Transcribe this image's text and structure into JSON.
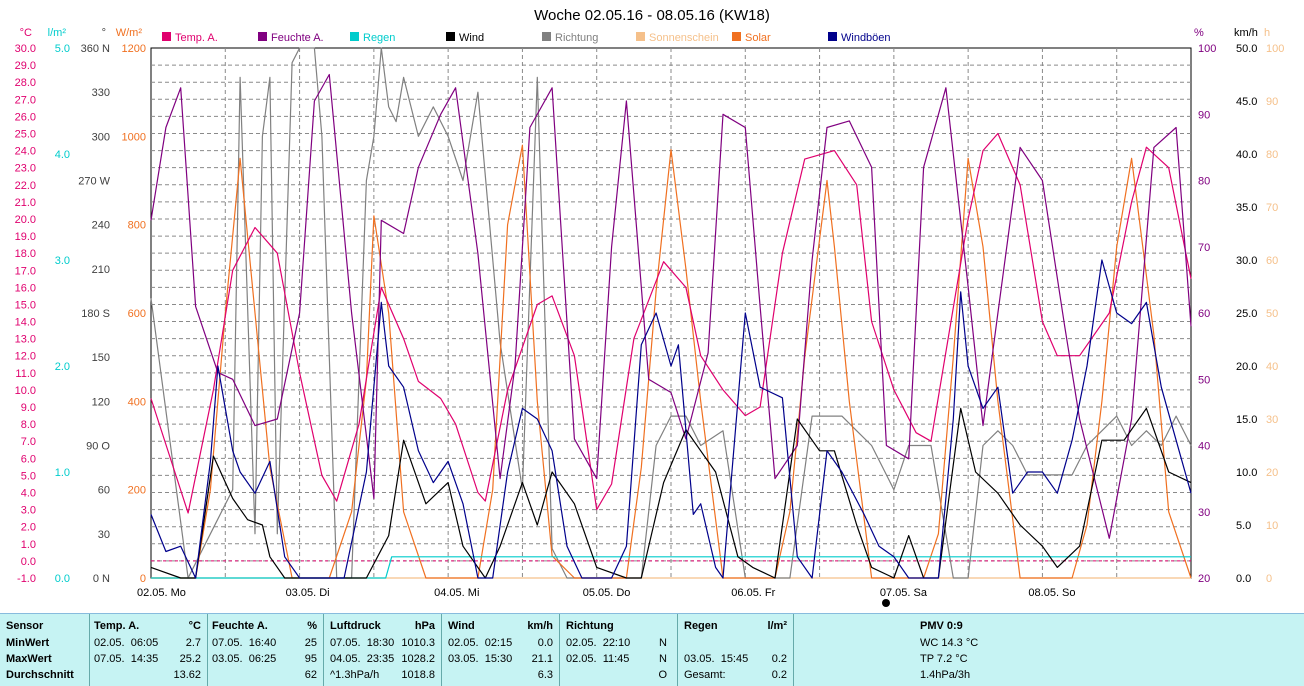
{
  "title": "Woche 02.05.16 - 08.05.16 (KW18)",
  "legend": [
    {
      "label": "Temp. A.",
      "color": "#e0006e"
    },
    {
      "label": "Feuchte A.",
      "color": "#800080"
    },
    {
      "label": "Regen",
      "color": "#00cccc"
    },
    {
      "label": "Wind",
      "color": "#000000"
    },
    {
      "label": "Richtung",
      "color": "#808080"
    },
    {
      "label": "Sonnenschein",
      "color": "#f5c08a"
    },
    {
      "label": "Solar",
      "color": "#f07020"
    },
    {
      "label": "Windböen",
      "color": "#00008b"
    }
  ],
  "axes_left": [
    {
      "unit": "°C",
      "color": "#e0006e",
      "ticks": [
        "30.0",
        "29.0",
        "28.0",
        "27.0",
        "26.0",
        "25.0",
        "24.0",
        "23.0",
        "22.0",
        "21.0",
        "20.0",
        "19.0",
        "18.0",
        "17.0",
        "16.0",
        "15.0",
        "14.0",
        "13.0",
        "12.0",
        "11.0",
        "10.0",
        "9.0",
        "8.0",
        "7.0",
        "6.0",
        "5.0",
        "4.0",
        "3.0",
        "2.0",
        "1.0",
        "0.0",
        "-1.0"
      ]
    },
    {
      "unit": "l/m²",
      "color": "#00cccc",
      "ticks": [
        "5.0",
        "4.0",
        "3.0",
        "2.0",
        "1.0",
        "0.0"
      ]
    },
    {
      "unit": "°",
      "color": "#404040",
      "ticks": [
        "360 N",
        "330",
        "300",
        "270 W",
        "240",
        "210",
        "180 S",
        "150",
        "120",
        "90 O",
        "60",
        "30",
        "0 N"
      ]
    },
    {
      "unit": "W/m²",
      "color": "#f07020",
      "ticks": [
        "1200",
        "1000",
        "800",
        "600",
        "400",
        "200",
        "0"
      ]
    }
  ],
  "axes_right": [
    {
      "unit": "%",
      "color": "#800080",
      "ticks": [
        "100",
        "90",
        "80",
        "70",
        "60",
        "50",
        "40",
        "30",
        "20"
      ]
    },
    {
      "unit": "km/h",
      "color": "#000000",
      "ticks": [
        "50.0",
        "45.0",
        "40.0",
        "35.0",
        "30.0",
        "25.0",
        "20.0",
        "15.0",
        "10.0",
        "5.0",
        "0.0"
      ]
    },
    {
      "unit": "h",
      "color": "#f5c08a",
      "ticks": [
        "100",
        "90",
        "80",
        "70",
        "60",
        "50",
        "40",
        "30",
        "20",
        "10",
        "0"
      ]
    }
  ],
  "x_labels": [
    "02.05.  Mo",
    "03.05.  Di",
    "04.05.  Mi",
    "05.05.  Do",
    "06.05.  Fr",
    "07.05.  Sa",
    "08.05.  So"
  ],
  "chart_data": {
    "type": "line",
    "title": "Woche 02.05.16 - 08.05.16 (KW18)",
    "x_unit": "days since 02.05.16 00:00",
    "x_range": [
      0,
      7
    ],
    "series": [
      {
        "name": "Temp. A.",
        "unit": "°C",
        "color": "#e0006e",
        "axis_range": [
          -1,
          30
        ],
        "x": [
          0,
          0.25,
          0.42,
          0.55,
          0.7,
          0.85,
          1.0,
          1.15,
          1.25,
          1.4,
          1.55,
          1.7,
          1.8,
          1.95,
          2.05,
          2.2,
          2.25,
          2.4,
          2.6,
          2.7,
          2.85,
          3.0,
          3.1,
          3.25,
          3.45,
          3.6,
          3.7,
          3.85,
          4.0,
          4.1,
          4.25,
          4.4,
          4.6,
          4.75,
          4.85,
          5.0,
          5.15,
          5.25,
          5.5,
          5.6,
          5.7,
          5.85,
          6.0,
          6.1,
          6.25,
          6.45,
          6.6,
          6.7,
          6.85,
          7.0
        ],
        "y": [
          9.5,
          2.8,
          10.0,
          17.0,
          19.5,
          18.0,
          11.0,
          5.0,
          3.5,
          8.0,
          16.0,
          13.0,
          10.5,
          9.5,
          8.0,
          4.0,
          3.5,
          10.0,
          15.0,
          15.5,
          12.0,
          3.0,
          4.5,
          13.0,
          17.5,
          16.0,
          12.0,
          10.0,
          8.5,
          9.0,
          18.0,
          23.5,
          24.0,
          22.0,
          14.0,
          10.0,
          7.5,
          7.0,
          20.0,
          24.0,
          25.0,
          22.0,
          14.0,
          12.0,
          12.0,
          14.5,
          21.0,
          24.2,
          23.0,
          16.5
        ]
      },
      {
        "name": "Feuchte A.",
        "unit": "%",
        "color": "#800080",
        "axis_range": [
          20,
          100
        ],
        "x": [
          0,
          0.1,
          0.2,
          0.3,
          0.45,
          0.55,
          0.7,
          0.85,
          1.0,
          1.1,
          1.2,
          1.35,
          1.5,
          1.55,
          1.7,
          1.8,
          1.95,
          2.05,
          2.2,
          2.35,
          2.45,
          2.55,
          2.7,
          2.85,
          3.0,
          3.1,
          3.2,
          3.35,
          3.5,
          3.6,
          3.75,
          3.85,
          4.0,
          4.1,
          4.2,
          4.35,
          4.45,
          4.55,
          4.7,
          4.85,
          4.95,
          5.1,
          5.2,
          5.35,
          5.5,
          5.6,
          5.7,
          5.85,
          6.0,
          6.15,
          6.25,
          6.45,
          6.6,
          6.75,
          6.9,
          7.0
        ],
        "y": [
          74,
          88,
          94,
          61,
          51,
          50,
          43,
          44,
          60,
          92,
          96,
          60,
          32,
          74,
          72,
          82,
          90,
          94,
          69,
          35,
          52,
          88,
          94,
          41,
          35,
          70,
          92,
          50,
          48,
          41,
          54,
          90,
          88,
          61,
          35,
          40,
          68,
          88,
          89,
          82,
          40,
          38,
          82,
          94,
          64,
          43,
          60,
          85,
          80,
          58,
          44,
          26,
          44,
          85,
          88,
          58
        ]
      },
      {
        "name": "Regen",
        "unit": "l/m²",
        "color": "#00cccc",
        "axis_range": [
          0,
          5
        ],
        "x": [
          0,
          1.58,
          1.62,
          7.0
        ],
        "y": [
          0,
          0,
          0.2,
          0.2
        ]
      },
      {
        "name": "Wind",
        "unit": "km/h",
        "color": "#000000",
        "axis_range": [
          0,
          50
        ],
        "x": [
          0,
          0.2,
          0.3,
          0.42,
          0.55,
          0.65,
          0.75,
          0.8,
          0.9,
          1.0,
          1.1,
          1.25,
          1.45,
          1.6,
          1.7,
          1.85,
          2.0,
          2.1,
          2.25,
          2.35,
          2.5,
          2.6,
          2.7,
          2.85,
          3.0,
          3.2,
          3.3,
          3.45,
          3.6,
          3.7,
          3.8,
          3.95,
          4.05,
          4.2,
          4.35,
          4.5,
          4.6,
          4.75,
          4.85,
          5.0,
          5.1,
          5.2,
          5.3,
          5.45,
          5.55,
          5.7,
          5.85,
          6.0,
          6.1,
          6.25,
          6.4,
          6.55,
          6.7,
          6.85,
          7.0
        ],
        "y": [
          1,
          0,
          0,
          11.5,
          7.5,
          5.5,
          5,
          2,
          0,
          0,
          0,
          0,
          0,
          4,
          13,
          7,
          9,
          3,
          0,
          3,
          9,
          5,
          10,
          7,
          1,
          0,
          0,
          9,
          14,
          12,
          10,
          2,
          1,
          0,
          15,
          12,
          12,
          5,
          1,
          0,
          4,
          0,
          0,
          16,
          10,
          8,
          5,
          3,
          1,
          3,
          13,
          13,
          16,
          10,
          9
        ]
      },
      {
        "name": "Richtung",
        "unit": "°",
        "color": "#808080",
        "axis_range": [
          0,
          360
        ],
        "x": [
          0,
          0.25,
          0.4,
          0.55,
          0.6,
          0.7,
          0.75,
          0.8,
          0.85,
          0.95,
          1.0,
          1.1,
          1.15,
          1.25,
          1.35,
          1.45,
          1.5,
          1.55,
          1.6,
          1.65,
          1.7,
          1.8,
          1.9,
          2.0,
          2.1,
          2.2,
          2.35,
          2.5,
          2.6,
          2.7,
          2.8,
          2.85,
          3.0,
          3.1,
          3.3,
          3.4,
          3.5,
          3.6,
          3.7,
          3.85,
          4.0,
          4.1,
          4.2,
          4.3,
          4.45,
          4.55,
          4.65,
          4.75,
          4.85,
          5.0,
          5.1,
          5.25,
          5.4,
          5.5,
          5.6,
          5.7,
          5.8,
          5.9,
          6.0,
          6.2,
          6.3,
          6.4,
          6.5,
          6.6,
          6.7,
          6.8,
          6.9,
          7.0
        ],
        "y": [
          190,
          0,
          30,
          60,
          340,
          30,
          300,
          340,
          30,
          350,
          360,
          360,
          300,
          0,
          0,
          270,
          300,
          360,
          320,
          310,
          340,
          300,
          320,
          300,
          270,
          330,
          160,
          60,
          340,
          20,
          0,
          0,
          0,
          0,
          0,
          90,
          110,
          110,
          90,
          100,
          0,
          0,
          0,
          0,
          110,
          110,
          110,
          100,
          90,
          60,
          90,
          90,
          0,
          0,
          90,
          100,
          90,
          70,
          70,
          70,
          90,
          100,
          110,
          90,
          100,
          90,
          110,
          90
        ]
      },
      {
        "name": "Sonnenschein",
        "unit": "h",
        "color": "#f5c08a",
        "axis_range": [
          0,
          100
        ],
        "x": [
          0,
          7
        ],
        "y": [
          0,
          0
        ]
      },
      {
        "name": "Solar",
        "unit": "W/m²",
        "color": "#f07020",
        "axis_range": [
          0,
          1200
        ],
        "x": [
          0,
          0.2,
          0.3,
          0.4,
          0.5,
          0.6,
          0.7,
          0.8,
          0.95,
          1.0,
          1.2,
          1.35,
          1.45,
          1.5,
          1.6,
          1.7,
          1.85,
          2.0,
          2.2,
          2.3,
          2.4,
          2.5,
          2.6,
          2.7,
          2.85,
          3.0,
          3.2,
          3.3,
          3.4,
          3.5,
          3.6,
          3.7,
          3.85,
          4.0,
          4.2,
          4.3,
          4.4,
          4.55,
          4.6,
          4.7,
          4.85,
          5.0,
          5.2,
          5.3,
          5.4,
          5.5,
          5.6,
          5.7,
          5.85,
          6.0,
          6.2,
          6.3,
          6.4,
          6.5,
          6.6,
          6.75,
          6.85,
          7.0
        ],
        "y": [
          0,
          0,
          0,
          200,
          600,
          950,
          600,
          250,
          0,
          0,
          0,
          150,
          450,
          820,
          600,
          150,
          0,
          0,
          0,
          200,
          800,
          980,
          400,
          50,
          0,
          0,
          0,
          250,
          650,
          970,
          700,
          400,
          0,
          0,
          0,
          150,
          500,
          900,
          750,
          400,
          0,
          0,
          0,
          100,
          500,
          950,
          750,
          400,
          0,
          0,
          0,
          120,
          400,
          750,
          950,
          550,
          150,
          0
        ]
      },
      {
        "name": "Windböen",
        "unit": "km/h",
        "color": "#00008b",
        "axis_range": [
          0,
          50
        ],
        "x": [
          0,
          0.1,
          0.2,
          0.3,
          0.4,
          0.45,
          0.55,
          0.6,
          0.7,
          0.8,
          0.9,
          1.0,
          1.15,
          1.3,
          1.45,
          1.55,
          1.6,
          1.7,
          1.8,
          1.9,
          2.0,
          2.1,
          2.2,
          2.3,
          2.4,
          2.5,
          2.6,
          2.7,
          2.8,
          2.9,
          3.0,
          3.1,
          3.2,
          3.3,
          3.4,
          3.5,
          3.55,
          3.65,
          3.7,
          3.8,
          3.85,
          4.0,
          4.1,
          4.25,
          4.35,
          4.45,
          4.55,
          4.65,
          4.8,
          4.9,
          5.0,
          5.1,
          5.2,
          5.3,
          5.4,
          5.45,
          5.5,
          5.6,
          5.7,
          5.8,
          5.9,
          6.0,
          6.1,
          6.2,
          6.3,
          6.4,
          6.5,
          6.6,
          6.7,
          6.8,
          6.9,
          7.0
        ],
        "y": [
          6,
          2.5,
          3,
          0,
          11,
          20,
          12,
          10,
          8,
          11,
          2,
          0,
          0,
          0,
          10,
          26,
          20,
          18,
          12,
          9,
          11,
          7,
          0,
          0,
          10,
          16,
          15,
          12,
          3,
          0,
          0,
          0,
          3,
          22,
          25,
          20,
          22,
          6,
          7,
          1,
          0,
          25,
          18,
          17,
          2,
          0,
          12,
          10,
          6,
          3,
          2,
          0,
          0,
          0,
          15,
          27,
          20,
          16,
          18,
          8,
          10,
          10,
          8,
          13,
          20,
          30,
          25,
          24,
          26,
          18,
          13,
          8
        ]
      }
    ]
  },
  "stats": {
    "sensor": {
      "head": "Sensor",
      "rows": [
        "MinWert",
        "MaxWert",
        "Durchschnitt"
      ]
    },
    "temp": {
      "head": "Temp. A.",
      "unit": "°C",
      "rows": [
        [
          "02.05.  06:05",
          "2.7"
        ],
        [
          "07.05.  14:35",
          "25.2"
        ],
        [
          "",
          "13.62"
        ]
      ]
    },
    "feuchte": {
      "head": "Feuchte A.",
      "unit": "%",
      "rows": [
        [
          "07.05.  16:40",
          "25"
        ],
        [
          "03.05.  06:25",
          "95"
        ],
        [
          "",
          "62"
        ]
      ]
    },
    "luftdruck": {
      "head": "Luftdruck",
      "unit": "hPa",
      "rows": [
        [
          "07.05.  18:30",
          "1010.3"
        ],
        [
          "04.05.  23:35",
          "1028.2"
        ],
        [
          "^1.3hPa/h",
          "1018.8"
        ]
      ]
    },
    "wind": {
      "head": "Wind",
      "unit": "km/h",
      "rows": [
        [
          "02.05.  02:15",
          "0.0"
        ],
        [
          "03.05.  15:30",
          "21.1"
        ],
        [
          "",
          "6.3"
        ]
      ]
    },
    "richtung": {
      "head": "Richtung",
      "rows": [
        [
          "02.05.  22:10",
          "N"
        ],
        [
          "02.05.  11:45",
          "N"
        ],
        [
          "",
          "O"
        ]
      ]
    },
    "regen": {
      "head": "Regen",
      "unit": "l/m²",
      "rows": [
        [
          "",
          ""
        ],
        [
          "03.05.  15:45",
          "0.2"
        ],
        [
          "Gesamt:",
          "0.2"
        ]
      ]
    },
    "pmv": {
      "head": "PMV 0:9",
      "rows": [
        "WC 14.3 °C",
        "TP 7.2 °C",
        "1.4hPa/3h"
      ]
    }
  }
}
